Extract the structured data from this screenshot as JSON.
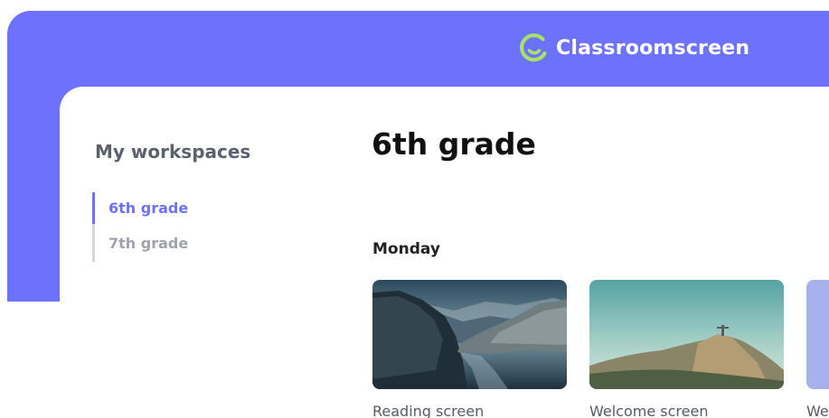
{
  "brand": {
    "name": "Classroomscreen",
    "logo_icon": "classroomscreen-logo-icon",
    "accent_color": "#6c72fc",
    "logo_color": "#a8e06a"
  },
  "sidebar": {
    "title": "My workspaces",
    "items": [
      {
        "label": "6th grade",
        "active": true
      },
      {
        "label": "7th grade",
        "active": false
      }
    ]
  },
  "main": {
    "title": "6th grade",
    "sections": [
      {
        "label": "Monday",
        "cards": [
          {
            "label": "Reading screen",
            "thumbnail": "fjord-landscape-image"
          },
          {
            "label": "Welcome screen",
            "thumbnail": "mountain-statue-image"
          },
          {
            "label": "We",
            "thumbnail": "blue-gradient-image"
          }
        ]
      }
    ]
  }
}
